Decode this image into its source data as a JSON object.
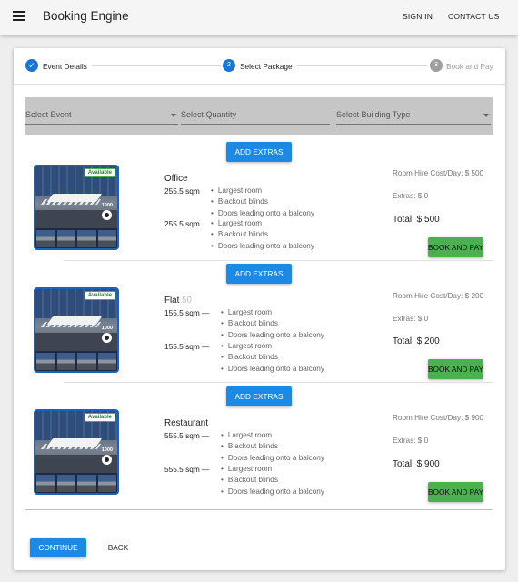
{
  "app": {
    "title": "Booking Engine",
    "nav": {
      "sign_in": "SIGN IN",
      "contact_us": "CONTACT US"
    }
  },
  "stepper": {
    "steps": [
      {
        "label": "Event Details",
        "state": "completed",
        "marker": "✓"
      },
      {
        "label": "Select Package",
        "state": "active",
        "marker": "2"
      },
      {
        "label": "Book and Pay",
        "state": "upcoming",
        "marker": "3"
      }
    ]
  },
  "filters": {
    "event": "Select Event",
    "quantity": "Select Quantity",
    "building_type": "Select Building Type"
  },
  "packages": [
    {
      "add_extras": "ADD EXTRAS",
      "available": "Available",
      "capacity": "1000",
      "name": "Office",
      "capacity_label": "",
      "sqm1": "255.5 sqm",
      "sqm2": "255.5 sqm",
      "features1": [
        "Largest room",
        "Blackout blinds",
        "Doors leading onto a balcony"
      ],
      "features2": [
        "Largest room",
        "Blackout blinds",
        "Doors leading onto a balcony"
      ],
      "room_hire": "Room Hire Cost/Day: $ 500",
      "extras": "Extras: $ 0",
      "total": "Total: $ 500",
      "book": "BOOK AND PAY"
    },
    {
      "add_extras": "ADD EXTRAS",
      "available": "Available",
      "capacity": "1000",
      "name": "Flat",
      "capacity_label": "50",
      "sqm1": "155.5 sqm —",
      "sqm2": "155.5 sqm —",
      "features1": [
        "Largest room",
        "Blackout blinds",
        "Doors leading onto a balcony"
      ],
      "features2": [
        "Largest room",
        "Blackout blinds",
        "Doors leading onto a balcony"
      ],
      "room_hire": "Room Hire Cost/Day: $ 200",
      "extras": "Extras: $ 0",
      "total": "Total: $ 200",
      "book": "BOOK AND PAY"
    },
    {
      "add_extras": "ADD EXTRAS",
      "available": "Available",
      "capacity": "1000",
      "name": "Restaurant",
      "capacity_label": "",
      "sqm1": "555.5 sqm —",
      "sqm2": "555.5 sqm —",
      "features1": [
        "Largest room",
        "Blackout blinds",
        "Doors leading onto a balcony"
      ],
      "features2": [
        "Largest room",
        "Blackout blinds",
        "Doors leading onto a balcony"
      ],
      "room_hire": "Room Hire Cost/Day: $ 900",
      "extras": "Extras: $ 0",
      "total": "Total: $ 900",
      "book": "BOOK AND PAY"
    }
  ],
  "footer": {
    "continue": "CONTINUE",
    "back": "BACK"
  },
  "colors": {
    "primary": "#1e88e5",
    "success": "#4caf50",
    "check": "#1976d2",
    "inactive": "#9e9e9e"
  },
  "icons": [
    "menu-icon",
    "check-icon",
    "dropdown-caret-icon",
    "available-badge",
    "capacity-icon"
  ]
}
